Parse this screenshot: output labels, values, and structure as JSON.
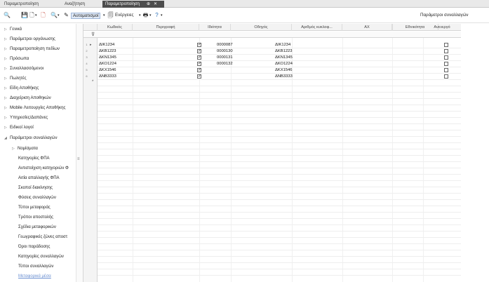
{
  "tabs": [
    {
      "label": "Παραμετροποίηση",
      "active": false
    },
    {
      "label": "Αναζήτηση",
      "active": false
    },
    {
      "label": "Παραμετροποίηση",
      "active": true,
      "pin": "⊕",
      "close": "✕"
    }
  ],
  "toolbar": {
    "automations_label": "Αυτοματισμοί",
    "actions_label": "Ενέργειες",
    "context_label": "Παράμετροι συναλλαγών",
    "icons": {
      "search": "🔍",
      "save": "💾",
      "new": "🗋",
      "delete": "🗋",
      "find": "🔍",
      "wand": "✎",
      "actions": "🗐",
      "print": "🖶",
      "help": "?",
      "dropdown": "▾",
      "pin": "⊕"
    }
  },
  "sidebar": {
    "items": [
      {
        "label": "Γενικά",
        "arrow": "▷"
      },
      {
        "label": "Παράμετροι οργάνωσης",
        "arrow": "▷"
      },
      {
        "label": "Παραμετροποίηση πεδίων",
        "arrow": "▷"
      },
      {
        "label": "Πρόσωπα",
        "arrow": "▷"
      },
      {
        "label": "Συναλλασσόμενοι",
        "arrow": "▷"
      },
      {
        "label": "Πωλητές",
        "arrow": "▷"
      },
      {
        "label": "Είδη Αποθήκης",
        "arrow": "▷"
      },
      {
        "label": "Διαχείριση Αποθηκών",
        "arrow": "▷"
      },
      {
        "label": "Mobile Λειτουργίες Αποθήκης",
        "arrow": "▷"
      },
      {
        "label": "Υπηρεσίες/Δαπάνες",
        "arrow": "▷"
      },
      {
        "label": "Ειδικοί λογοί",
        "arrow": "▷"
      },
      {
        "label": "Παράμετροι συναλλαγών",
        "arrow": "◢"
      }
    ],
    "subitem_currency": {
      "label": "Νομίσματα",
      "arrow": "▷"
    },
    "subitems": [
      "Κατηγορίες ΦΠΑ",
      "Αντιστοίχιση κατηγοριών Φ",
      "Αιτία απαλλαγής ΦΠΑ",
      "Σκοποί διακίνησης",
      "Φύσεις συναλλαγών",
      "Τύποι μεταφοράς",
      "Τρόποι αποστολής",
      "Σχέδια μεταφορικών",
      "Γεωγραφικές ζώνες αποστ",
      "Όροι παράδοσης",
      "Κατηγορίες συναλλαγών",
      "Τύποι συναλλαγών"
    ],
    "last_link": "Μεταφορικά μέσα",
    "resize_grip": "≡"
  },
  "grid": {
    "columns": [
      "Κωδικός",
      "Περιγραφή",
      "Ιδιότητα",
      "Οδηγός",
      "Αριθμός κυκλοφ...",
      "ΑΧ",
      "Εθνικότητα",
      "Ανενεργό"
    ],
    "filter_icon": "⊽",
    "current_row_marker": "▸",
    "new_row_marker": "*",
    "rows": [
      {
        "num": "1",
        "code": "ΔΙΚ1234",
        "desc": "",
        "prop": true,
        "driver": "0000087",
        "plate": "ΔΙΚ1234",
        "ax": "",
        "nat": "",
        "inactive": false
      },
      {
        "num": "2",
        "code": "ΔΚΒ1223",
        "desc": "",
        "prop": true,
        "driver": "0000130",
        "plate": "ΔΚΒ1223",
        "ax": "",
        "nat": "",
        "inactive": false
      },
      {
        "num": "3",
        "code": "ΔΚΝ1345",
        "desc": "",
        "prop": true,
        "driver": "0000131",
        "plate": "ΔΚΝ1345",
        "ax": "",
        "nat": "",
        "inactive": false
      },
      {
        "num": "4",
        "code": "ΔΚΟ1224",
        "desc": "",
        "prop": true,
        "driver": "0000132",
        "plate": "ΔΚΟ1224",
        "ax": "",
        "nat": "",
        "inactive": false
      },
      {
        "num": "5",
        "code": "ΔΚΧ1546",
        "desc": "",
        "prop": true,
        "driver": "",
        "plate": "ΔΚΧ1546",
        "ax": "",
        "nat": "",
        "inactive": false
      },
      {
        "num": "6",
        "code": "ΔΝΒ3333",
        "desc": "",
        "prop": true,
        "driver": "",
        "plate": "ΔΝΒ3333",
        "ax": "",
        "nat": "",
        "inactive": false
      }
    ]
  }
}
